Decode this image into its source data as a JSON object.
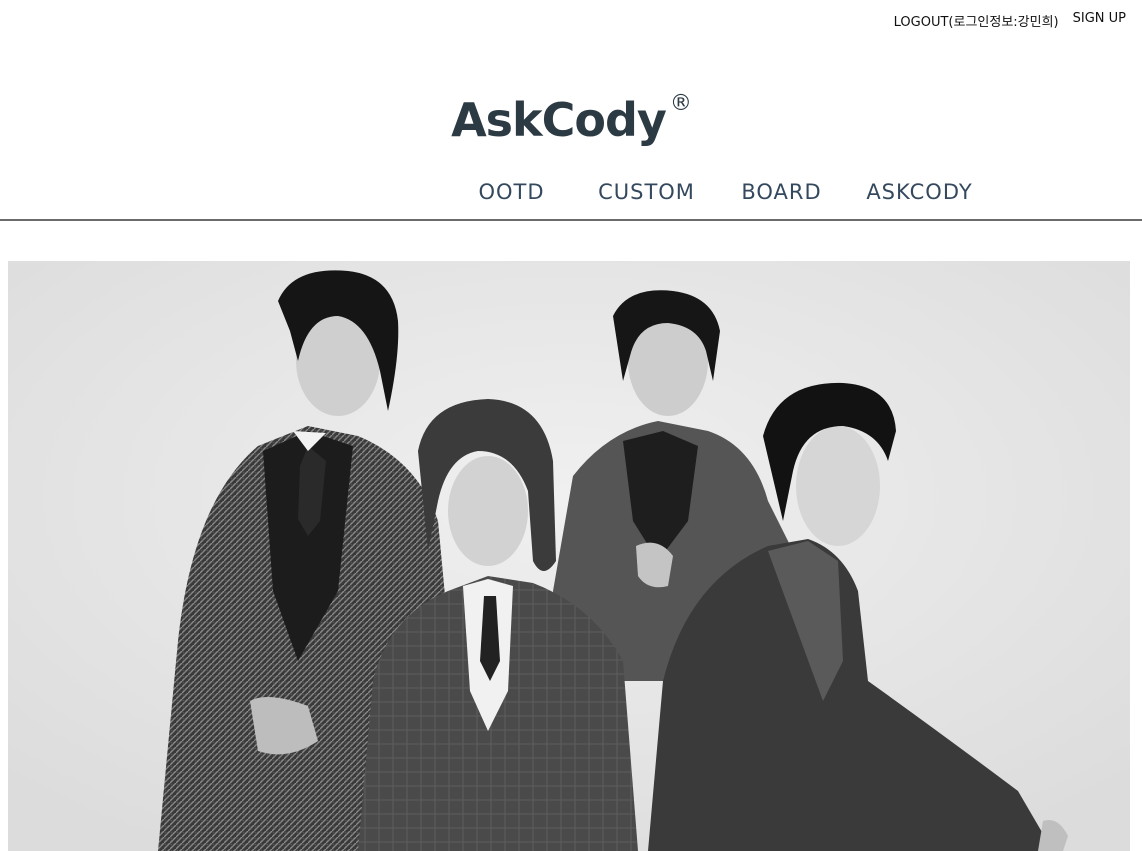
{
  "header": {
    "logout_label": "LOGOUT(로그인정보:강민희)",
    "signup_label": "SIGN UP"
  },
  "brand": {
    "name": "AskCody",
    "mark": "®",
    "color": "#2c3a44"
  },
  "nav": {
    "items": [
      {
        "label": "OOTD"
      },
      {
        "label": "CUSTOM"
      },
      {
        "label": "BOARD"
      },
      {
        "label": "ASKCODY"
      }
    ]
  },
  "hero": {
    "description_icon": "fashion-photo-image"
  }
}
